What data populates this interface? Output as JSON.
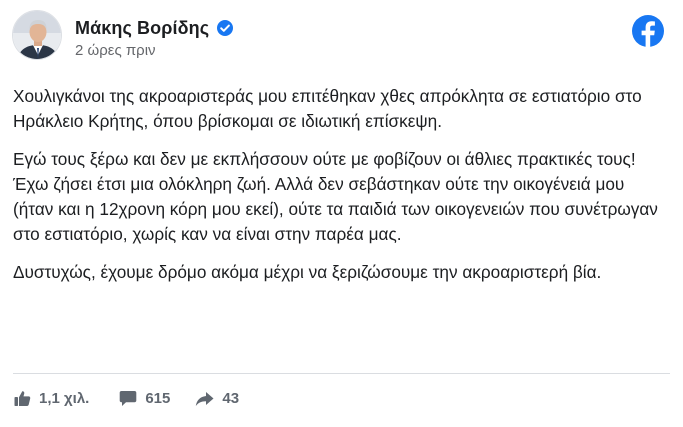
{
  "post": {
    "author": "Μάκης Βορίδης",
    "timestamp": "2 ώρες πριν",
    "paragraphs": [
      "Χουλιγκάνοι της ακροαριστεράς μου επιτέθηκαν χθες απρόκλητα σε εστιατόριο στο Ηράκλειο Κρήτης, όπου βρίσκομαι σε ιδιωτική επίσκεψη.",
      "Εγώ τους ξέρω και δεν με εκπλήσσουν ούτε με φοβίζουν οι άθλιες πρακτικές τους! Έχω ζήσει έτσι μια ολόκληρη ζωή. Αλλά δεν σεβάστηκαν ούτε την οικογένειά μου (ήταν και η 12χρονη κόρη μου εκεί), ούτε τα παιδιά των οικογενειών που συνέτρωγαν στο εστιατόριο, χωρίς καν να είναι στην παρέα μας.",
      "Δυστυχώς, έχουμε δρόμο ακόμα μέχρι να ξεριζώσουμε την ακροαριστερή βία."
    ]
  },
  "stats": {
    "likes": "1,1 χιλ.",
    "comments": "615",
    "shares": "43"
  },
  "icons": {
    "verified": "verified-badge-icon",
    "platform": "facebook-logo-icon",
    "like": "thumbs-up-icon",
    "comment": "comment-bubble-icon",
    "share": "share-arrow-icon"
  },
  "colors": {
    "brand": "#1877F2",
    "text": "#1c1e21",
    "secondary_text": "#65676b",
    "action_text": "#606770"
  }
}
